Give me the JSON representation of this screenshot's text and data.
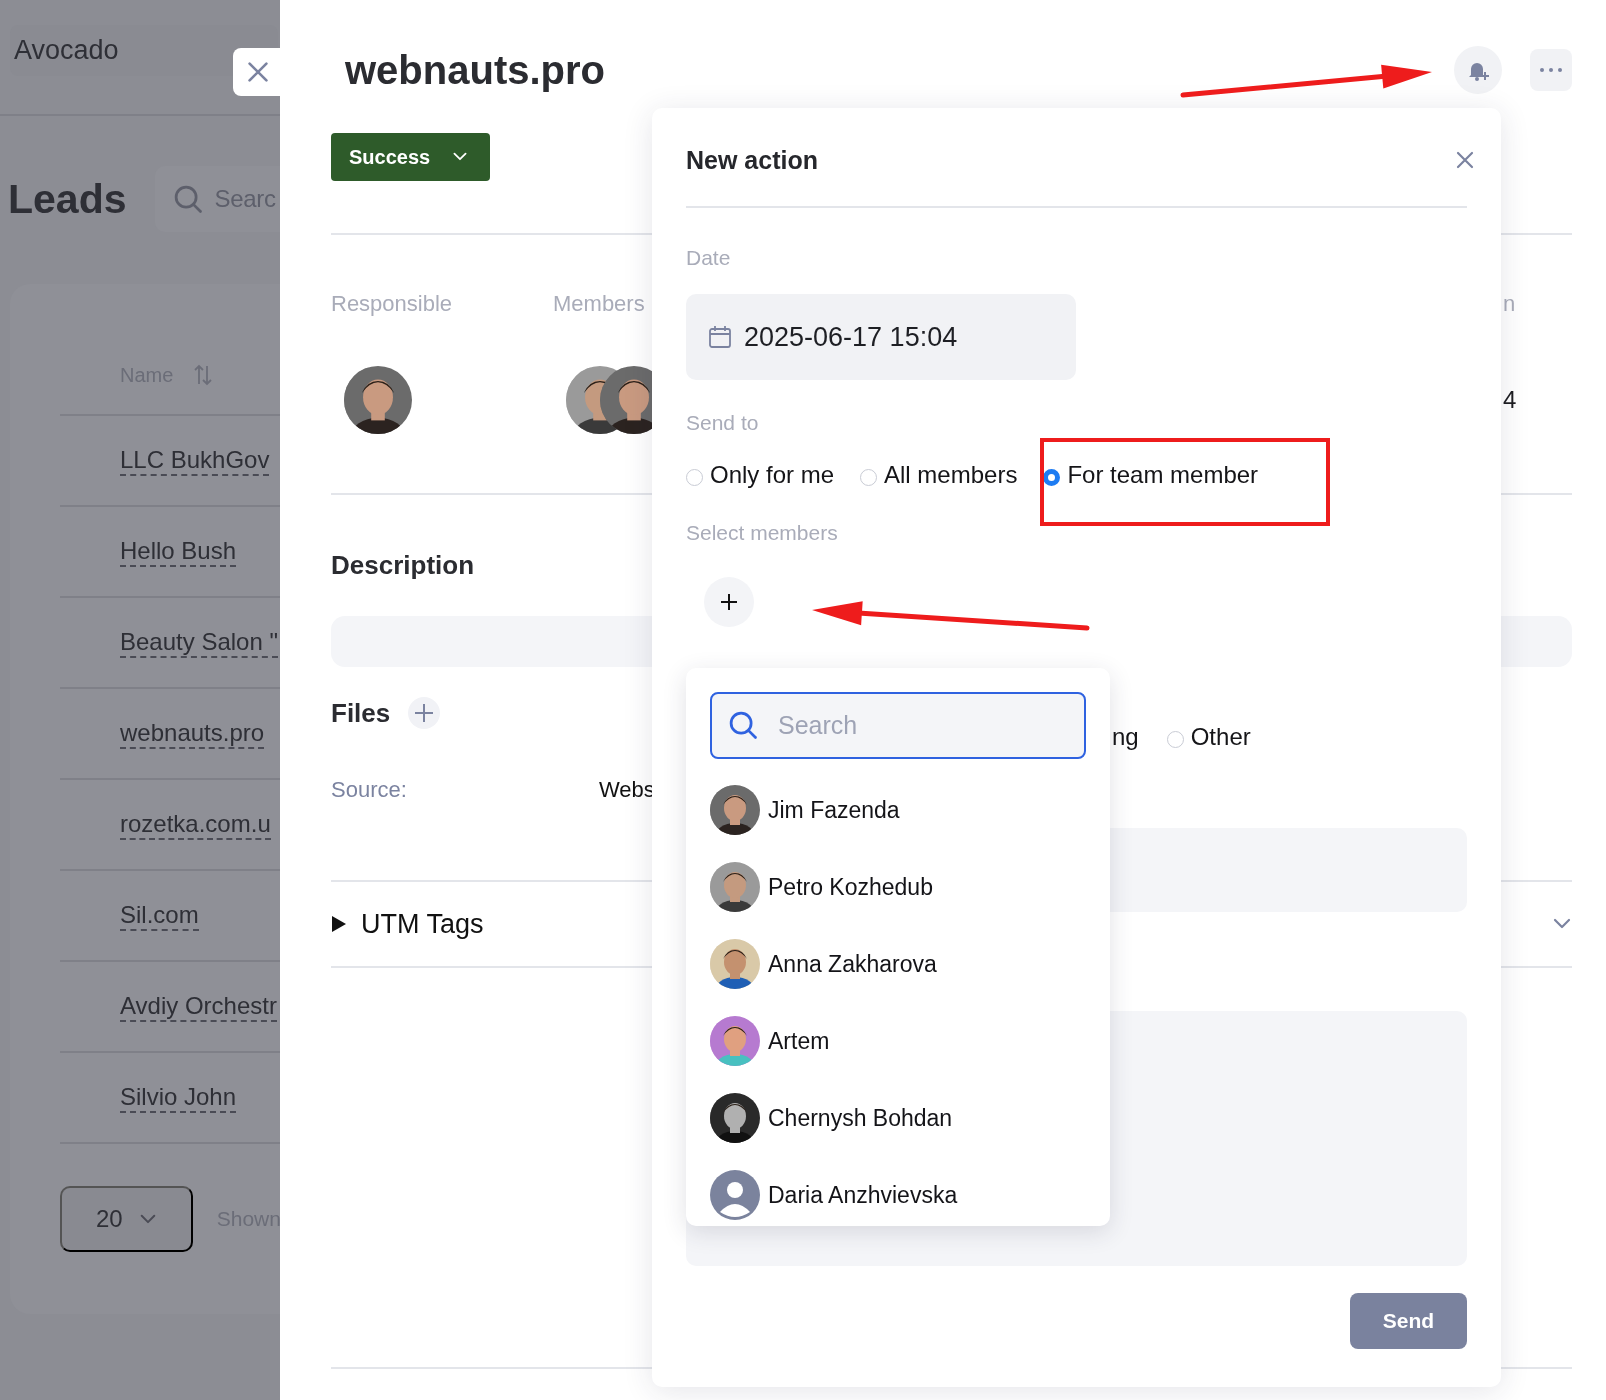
{
  "background_page": {
    "brand": "Avocado",
    "title": "Leads",
    "search": {
      "placeholder": "Searc"
    },
    "table": {
      "columns": [
        {
          "label": "Name"
        }
      ],
      "rows": [
        {
          "name": "LLC BukhGov"
        },
        {
          "name": "Hello Bush"
        },
        {
          "name": "Beauty Salon \""
        },
        {
          "name": "webnauts.pro"
        },
        {
          "name": "rozetka.com.u"
        },
        {
          "name": "Sil.com"
        },
        {
          "name": "Avdiy Orchestr"
        },
        {
          "name": "Silvio John"
        }
      ]
    },
    "page_size": "20",
    "shown_label": "Shown"
  },
  "drawer": {
    "title": "webnauts.pro",
    "status": "Success",
    "columns": [
      "Responsible",
      "Members",
      "n"
    ],
    "column_3_value": "4",
    "description_label": "Description",
    "files_label": "Files",
    "source_label": "Source:",
    "source_value": "Webs",
    "utm": {
      "label": "UTM Tags",
      "expanded": false
    }
  },
  "modal": {
    "title": "New action",
    "date_label": "Date",
    "date_value": "2025-06-17 15:04",
    "send_to_label": "Send to",
    "send_to_options": [
      {
        "label": "Only for me",
        "selected": false
      },
      {
        "label": "All members",
        "selected": false
      },
      {
        "label": "For team member",
        "selected": true
      }
    ],
    "select_members_label": "Select members",
    "type_options": [
      {
        "label": "ng"
      },
      {
        "label": "Other",
        "selected": false
      }
    ],
    "send_button": "Send"
  },
  "member_picker": {
    "search": {
      "placeholder": "Search"
    },
    "members": [
      {
        "name": "Jim Fazenda",
        "kind": "picture"
      },
      {
        "name": "Petro Kozhedub",
        "kind": "picture"
      },
      {
        "name": "Anna Zakharova",
        "kind": "picture"
      },
      {
        "name": "Artem",
        "kind": "picture"
      },
      {
        "name": "Chernysh Bohdan",
        "kind": "picture"
      },
      {
        "name": "Daria Anzhvievska",
        "kind": "default_avatar"
      }
    ]
  },
  "annotations": [
    {
      "kind": "arrow"
    },
    {
      "kind": "frame"
    },
    {
      "kind": "arrow"
    }
  ]
}
